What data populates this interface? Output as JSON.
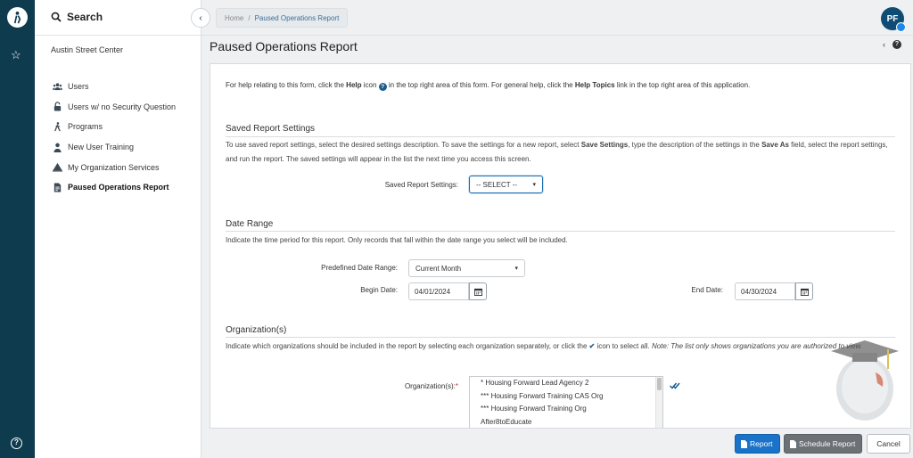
{
  "sidebar": {
    "search_label": "Search",
    "org_name": "Austin Street Center",
    "items": [
      {
        "label": "Users",
        "icon": "users-icon"
      },
      {
        "label": "Users w/ no Security Question",
        "icon": "lock-icon"
      },
      {
        "label": "Programs",
        "icon": "person-walking-icon"
      },
      {
        "label": "New User Training",
        "icon": "person-icon"
      },
      {
        "label": "My Organization Services",
        "icon": "tent-icon"
      },
      {
        "label": "Paused Operations Report",
        "icon": "report-icon",
        "active": true
      }
    ]
  },
  "breadcrumb": {
    "home": "Home",
    "separator": "/",
    "current": "Paused Operations Report"
  },
  "user": {
    "initials": "PF"
  },
  "page": {
    "title": "Paused Operations Report"
  },
  "help_line": {
    "p1": "For help relating to this form, click the ",
    "help_word": "Help",
    "p2": " icon ",
    "p3": " in the top right area of this form.  For general help, click the ",
    "topics_word": "Help Topics",
    "p4": " link in the top right area of this application."
  },
  "saved_settings": {
    "title": "Saved Report Settings",
    "desc_p1": "To use saved report settings, select the desired settings description. To save the settings for a new report, select ",
    "desc_b1": "Save Settings",
    "desc_p2": ", type the description of the settings in the ",
    "desc_b2": "Save As",
    "desc_p3": " field, select the report settings, and run the report. The saved settings will appear in the list the next time you access this screen.",
    "label": "Saved Report Settings:",
    "value": "-- SELECT --"
  },
  "date_range": {
    "title": "Date Range",
    "desc": "Indicate the time period for this report. Only records that fall within the date range you select will be included.",
    "predefined_label": "Predefined Date Range:",
    "predefined_value": "Current Month",
    "begin_label": "Begin Date:",
    "begin_value": "04/01/2024",
    "end_label": "End Date:",
    "end_value": "04/30/2024"
  },
  "organizations": {
    "title": "Organization(s)",
    "desc_p1": "Indicate which organizations should be included in the report by selecting each organization separately, or click the ",
    "desc_p2": " icon to select all. ",
    "desc_note": "Note: The list only shows organizations you are authorized to view.",
    "label": "Organization(s):",
    "required_mark": "*",
    "options": [
      "* Housing Forward Lead Agency 2",
      "*** Housing Forward Training CAS Org",
      "*** Housing Forward Training Org",
      "After8toEducate"
    ]
  },
  "footer": {
    "report_label": "Report",
    "schedule_label": "Schedule Report",
    "cancel_label": "Cancel"
  },
  "colors": {
    "rail": "#0f3b4f",
    "primary_button": "#1a73c8",
    "secondary_button": "#6b7175",
    "avatar": "#0f4c75"
  }
}
